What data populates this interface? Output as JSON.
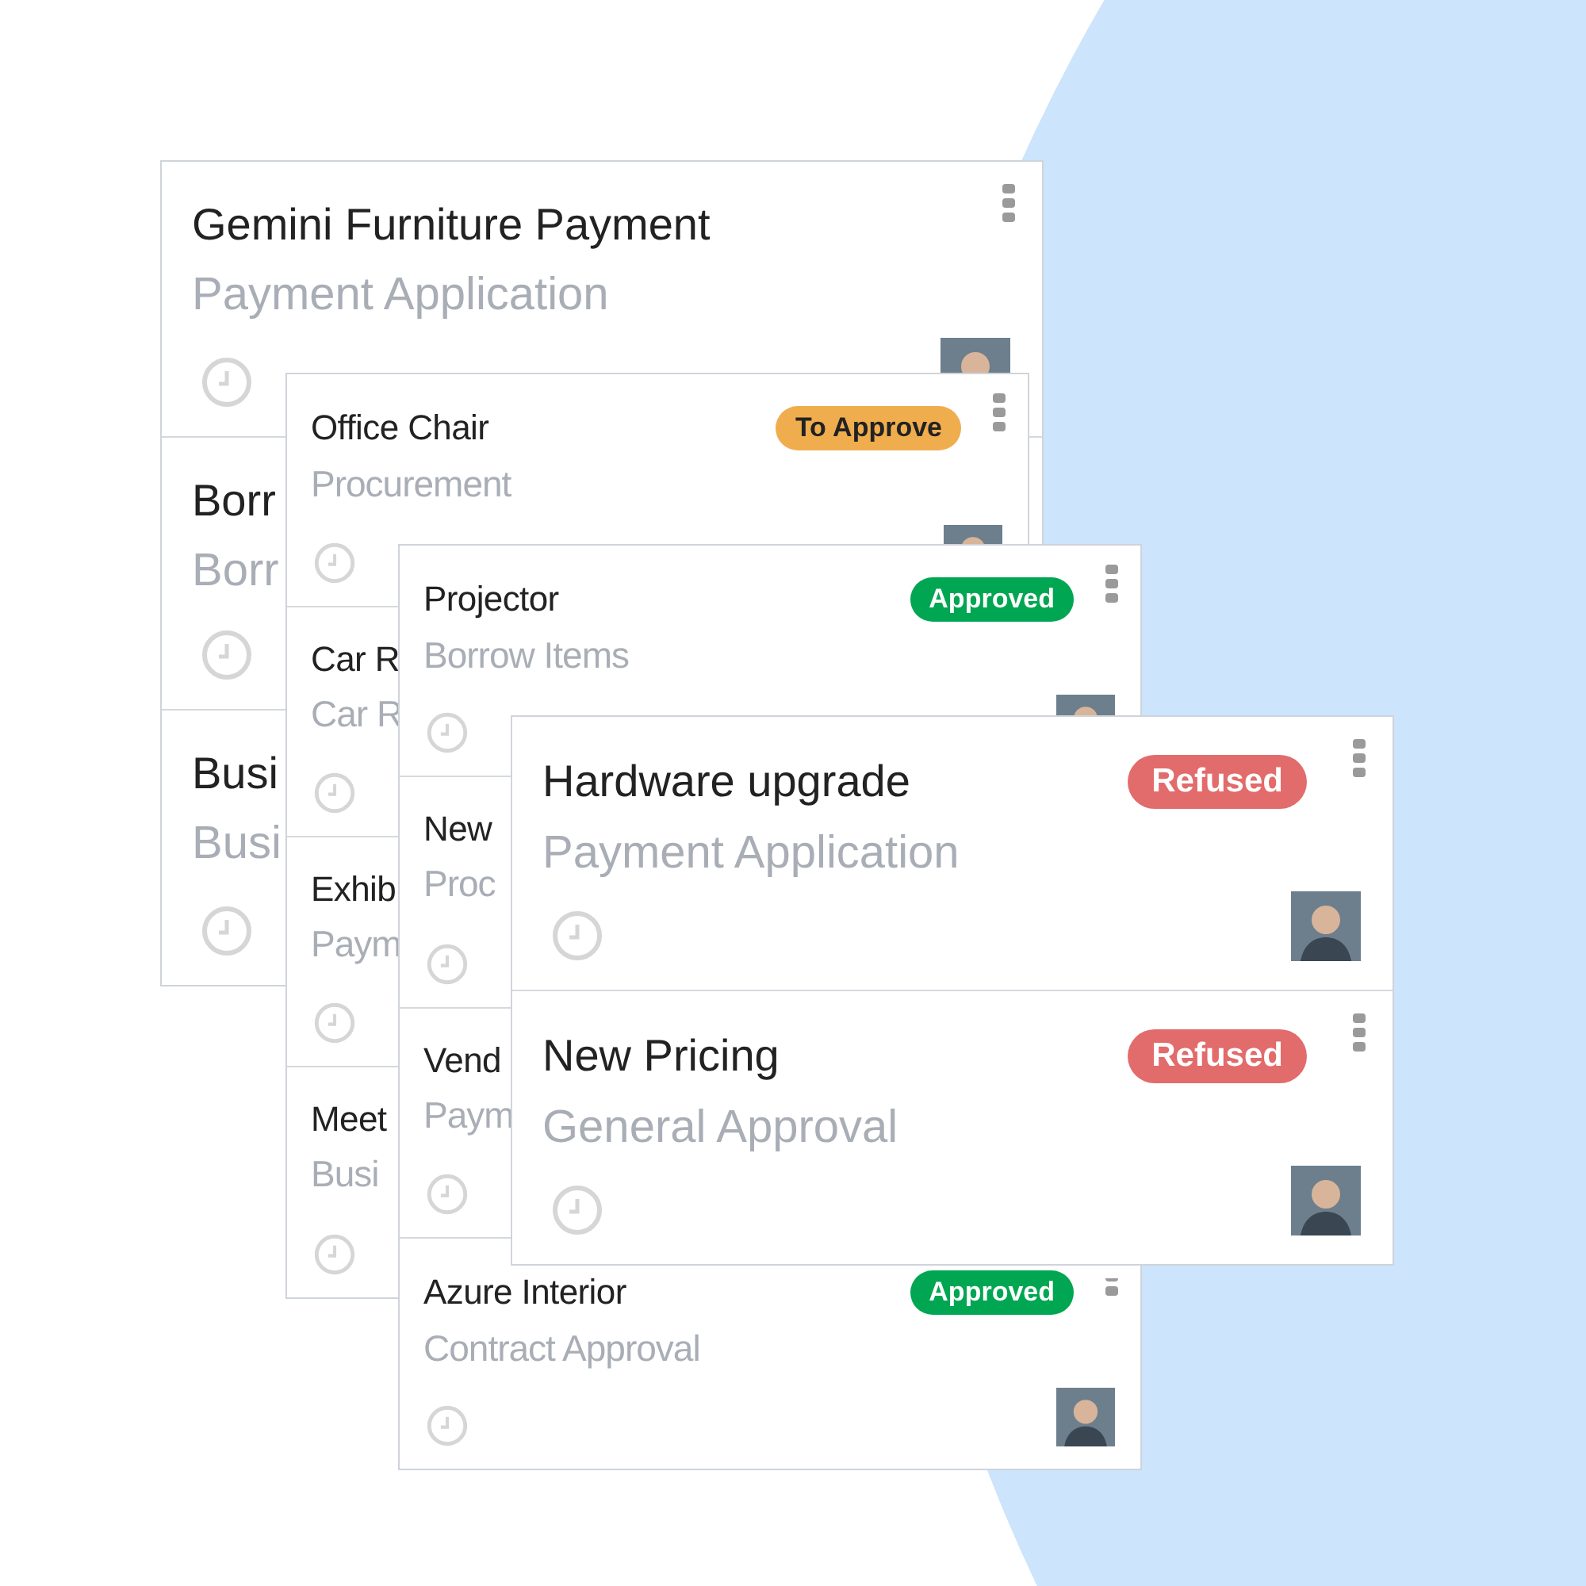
{
  "stacks": [
    {
      "cards": [
        {
          "title": "Gemini Furniture Payment",
          "subtitle": "Payment Application",
          "avatar": true,
          "menu": true
        },
        {
          "title": "Borr",
          "subtitle": "Borr"
        },
        {
          "title": "Busi",
          "subtitle": "Busi"
        }
      ]
    },
    {
      "cards": [
        {
          "title": "Office Chair",
          "subtitle": "Procurement",
          "badge": {
            "label": "To Approve",
            "color": "#f0ad4e"
          },
          "avatar": true,
          "menu": true
        },
        {
          "title": "Car R",
          "subtitle": "Car R"
        },
        {
          "title": "Exhib",
          "subtitle": "Paym"
        },
        {
          "title": "Meet",
          "subtitle": "Busi"
        }
      ]
    },
    {
      "cards": [
        {
          "title": "Projector",
          "subtitle": "Borrow Items",
          "badge": {
            "label": "Approved",
            "color": "#00a651"
          },
          "avatar": true,
          "menu": true
        },
        {
          "title": "New",
          "subtitle": "Proc"
        },
        {
          "title": "Vend",
          "subtitle": "Paym"
        },
        {
          "title": "Azure Interior",
          "subtitle": "Contract Approval",
          "badge": {
            "label": "Approved",
            "color": "#00a651"
          },
          "avatar": true,
          "menu": true
        }
      ]
    },
    {
      "cards": [
        {
          "title": "Hardware upgrade",
          "subtitle": "Payment Application",
          "badge": {
            "label": "Refused",
            "color": "#e26b6b"
          },
          "avatar": true,
          "menu": true
        },
        {
          "title": "New Pricing",
          "subtitle": "General Approval",
          "badge": {
            "label": "Refused",
            "color": "#e26b6b"
          },
          "avatar": true,
          "menu": true
        }
      ]
    }
  ]
}
